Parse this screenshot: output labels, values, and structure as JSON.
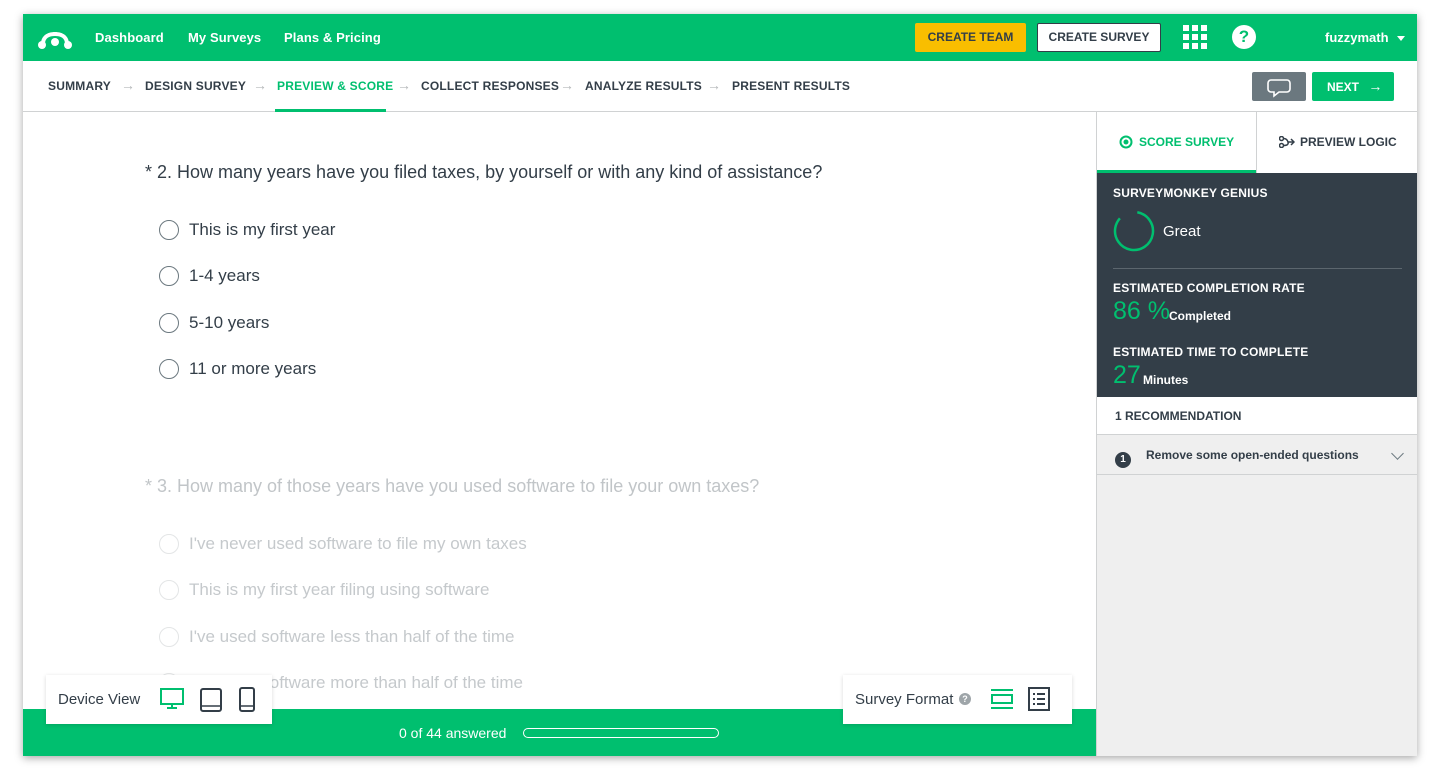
{
  "topnav": {
    "links": [
      "Dashboard",
      "My Surveys",
      "Plans & Pricing"
    ],
    "create_team": "CREATE TEAM",
    "create_survey": "CREATE SURVEY",
    "help": "?",
    "user": "fuzzymath"
  },
  "steps": {
    "items": [
      "SUMMARY",
      "DESIGN SURVEY",
      "PREVIEW & SCORE",
      "COLLECT RESPONSES",
      "ANALYZE RESULTS",
      "PRESENT RESULTS"
    ],
    "active": "PREVIEW & SCORE",
    "next": "NEXT"
  },
  "questions": [
    {
      "title": "* 2. How many years have you filed taxes, by yourself or with any kind of assistance?",
      "options": [
        "This is my first year",
        "1-4 years",
        "5-10 years",
        "11 or more years"
      ]
    },
    {
      "title": "* 3. How many of those years have you used software to file your own taxes?",
      "options": [
        "I've never used software to file my own taxes",
        "This is my first year filing using software",
        "I've used software less than half of the time",
        "I've used software more than half of the time"
      ]
    }
  ],
  "progress": {
    "text": "0 of 44 answered",
    "fraction": 0
  },
  "device_view": {
    "label": "Device View",
    "icons": [
      "desktop-icon",
      "tablet-icon",
      "phone-icon"
    ],
    "active": "desktop-icon"
  },
  "survey_format": {
    "label": "Survey Format",
    "icons": [
      "one-question-at-a-time-icon",
      "classic-format-icon"
    ]
  },
  "right_panel": {
    "tabs": [
      "SCORE SURVEY",
      "PREVIEW LOGIC"
    ],
    "genius_title": "SURVEYMONKEY GENIUS",
    "genius_rating": "Great",
    "completion_title": "ESTIMATED COMPLETION RATE",
    "completion_value": "86 %",
    "completion_unit": "Completed",
    "time_title": "ESTIMATED TIME TO COMPLETE",
    "time_value": "27",
    "time_unit": "Minutes",
    "recommendations_title": "1 RECOMMENDATION",
    "recommendations": [
      {
        "num": "1",
        "text": "Remove some open-ended questions"
      }
    ]
  },
  "colors": {
    "brand_green": "#00bf6f",
    "dark": "#333e48",
    "team_yellow": "#f9be00"
  }
}
